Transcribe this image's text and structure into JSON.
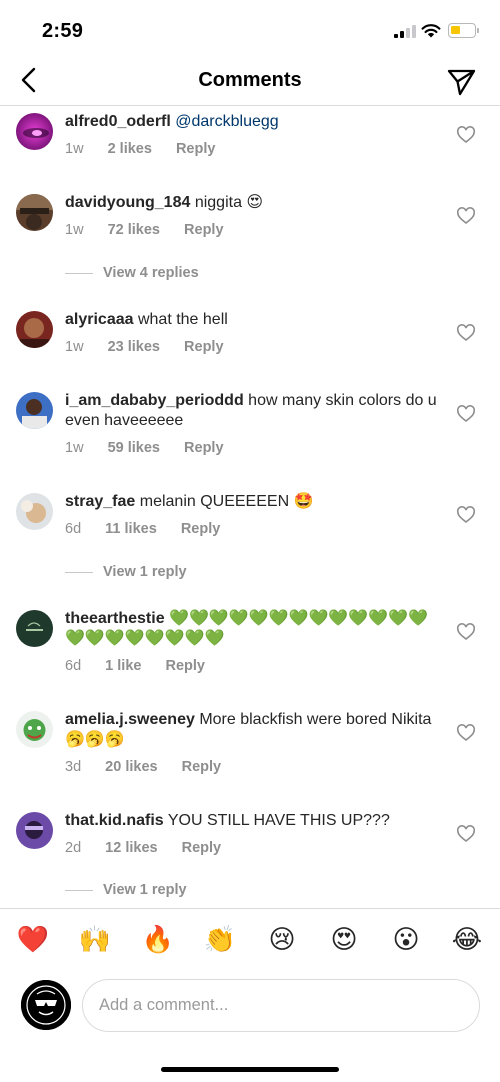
{
  "status_bar": {
    "time": "2:59"
  },
  "header": {
    "title": "Comments"
  },
  "comments": [
    {
      "username": "alfred0_oderfl",
      "text": "",
      "mention": "@darckbluegg",
      "time": "1w",
      "likes": "2 likes",
      "reply": "Reply"
    },
    {
      "username": "davidyoung_184",
      "text": "niggita 😍",
      "time": "1w",
      "likes": "72 likes",
      "reply": "Reply",
      "view_replies": "View 4 replies"
    },
    {
      "username": "alyricaaa",
      "text": "what the hell",
      "time": "1w",
      "likes": "23 likes",
      "reply": "Reply"
    },
    {
      "username": "i_am_dababy_perioddd",
      "text": "how many skin colors do u even haveeeeee",
      "time": "1w",
      "likes": "59 likes",
      "reply": "Reply"
    },
    {
      "username": "stray_fae",
      "text": "melanin QUEEEEEN 🤩",
      "time": "6d",
      "likes": "11 likes",
      "reply": "Reply",
      "view_replies": "View 1 reply"
    },
    {
      "username": "theearthestie",
      "text": "💚💚💚💚💚💚💚💚💚💚💚💚💚💚💚💚💚💚💚💚💚",
      "time": "6d",
      "likes": "1 like",
      "reply": "Reply"
    },
    {
      "username": "amelia.j.sweeney",
      "text": "More blackfish were bored Nikita🥱🥱🥱",
      "time": "3d",
      "likes": "20 likes",
      "reply": "Reply"
    },
    {
      "username": "that.kid.nafis",
      "text": "YOU STILL HAVE THIS UP???",
      "time": "2d",
      "likes": "12 likes",
      "reply": "Reply",
      "view_replies": "View 1 reply"
    }
  ],
  "emoji_bar": [
    "❤️",
    "🙌",
    "🔥",
    "👏",
    "😢",
    "😍",
    "😮",
    "😂"
  ],
  "composer": {
    "placeholder": "Add a comment..."
  },
  "colors": {
    "text": "#262626",
    "meta": "#8e8e8e",
    "mention": "#00376b",
    "divider": "#dbdbdb",
    "battery": "#f7c600"
  },
  "icons": [
    "back-arrow-icon",
    "send-icon",
    "heart-outline-icon",
    "signal-icon",
    "wifi-icon",
    "battery-icon"
  ]
}
